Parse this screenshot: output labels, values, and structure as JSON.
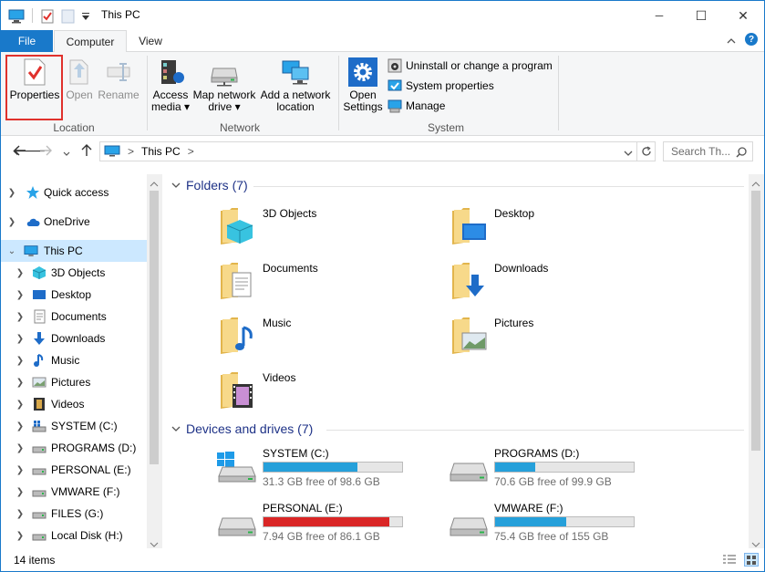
{
  "window": {
    "title": "This PC"
  },
  "title_buttons": {
    "minimize": "─",
    "maximize": "☐",
    "close": "✕"
  },
  "tabs": {
    "file": "File",
    "computer": "Computer",
    "view": "View"
  },
  "ribbon": {
    "properties": "Properties",
    "open": "Open",
    "rename": "Rename",
    "location_group": "Location",
    "access_media_1": "Access",
    "access_media_2": "media ▾",
    "map_drive_1": "Map network",
    "map_drive_2": "drive ▾",
    "add_location_1": "Add a network",
    "add_location_2": "location",
    "network_group": "Network",
    "open_settings_1": "Open",
    "open_settings_2": "Settings",
    "uninstall": "Uninstall or change a program",
    "system_properties": "System properties",
    "manage": "Manage",
    "system_group": "System"
  },
  "address": {
    "crumb": "This PC",
    "crumb_sep": ">",
    "search_placeholder": "Search Th..."
  },
  "nav": {
    "items": [
      {
        "label": "Quick access"
      },
      {
        "label": "OneDrive"
      },
      {
        "label": "This PC"
      },
      {
        "label": "3D Objects"
      },
      {
        "label": "Desktop"
      },
      {
        "label": "Documents"
      },
      {
        "label": "Downloads"
      },
      {
        "label": "Music"
      },
      {
        "label": "Pictures"
      },
      {
        "label": "Videos"
      },
      {
        "label": "SYSTEM (C:)"
      },
      {
        "label": "PROGRAMS (D:)"
      },
      {
        "label": "PERSONAL (E:)"
      },
      {
        "label": "VMWARE (F:)"
      },
      {
        "label": "FILES (G:)"
      },
      {
        "label": "Local Disk (H:)"
      }
    ]
  },
  "folders": {
    "header": "Folders (7)",
    "items": [
      {
        "name": "3D Objects"
      },
      {
        "name": "Desktop"
      },
      {
        "name": "Documents"
      },
      {
        "name": "Downloads"
      },
      {
        "name": "Music"
      },
      {
        "name": "Pictures"
      },
      {
        "name": "Videos"
      }
    ]
  },
  "drives": {
    "header": "Devices and drives (7)",
    "items": [
      {
        "name": "SYSTEM (C:)",
        "free": "31.3 GB free of 98.6 GB",
        "used_fraction": 0.68,
        "color": "#26a0da"
      },
      {
        "name": "PROGRAMS (D:)",
        "free": "70.6 GB free of 99.9 GB",
        "used_fraction": 0.29,
        "color": "#26a0da"
      },
      {
        "name": "PERSONAL (E:)",
        "free": "7.94 GB free of 86.1 GB",
        "used_fraction": 0.91,
        "color": "#da2626"
      },
      {
        "name": "VMWARE (F:)",
        "free": "75.4 GB free of 155 GB",
        "used_fraction": 0.51,
        "color": "#26a0da"
      }
    ]
  },
  "status": {
    "count": "14 items"
  },
  "colors": {
    "accent": "#1979ca",
    "selected": "#cce8ff",
    "highlight_border": "#e0312c"
  }
}
